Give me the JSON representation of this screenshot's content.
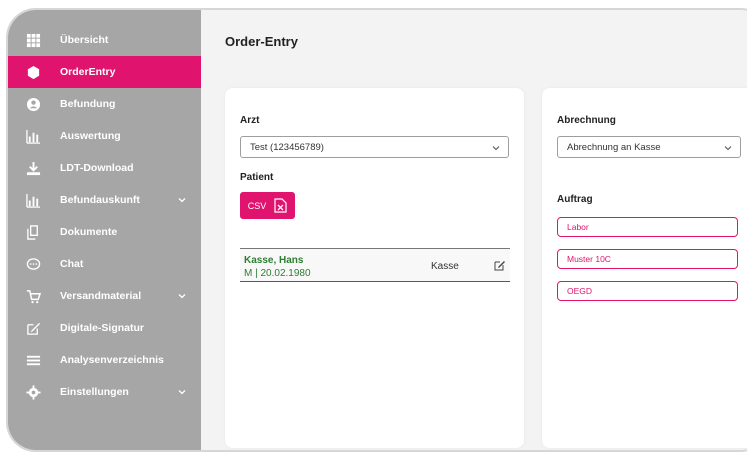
{
  "colors": {
    "accent": "#e0146f",
    "sidebar": "#a6a6a6",
    "patient_green": "#2e7d32"
  },
  "sidebar": {
    "items": [
      {
        "label": "Übersicht",
        "icon": "grid-icon",
        "active": false,
        "has_caret": false
      },
      {
        "label": "OrderEntry",
        "icon": "cube-icon",
        "active": true,
        "has_caret": false
      },
      {
        "label": "Befundung",
        "icon": "user-circle-icon",
        "active": false,
        "has_caret": false
      },
      {
        "label": "Auswertung",
        "icon": "bar-chart-icon",
        "active": false,
        "has_caret": false
      },
      {
        "label": "LDT-Download",
        "icon": "download-icon",
        "active": false,
        "has_caret": false
      },
      {
        "label": "Befundauskunft",
        "icon": "bar-chart-icon",
        "active": false,
        "has_caret": true
      },
      {
        "label": "Dokumente",
        "icon": "documents-icon",
        "active": false,
        "has_caret": false
      },
      {
        "label": "Chat",
        "icon": "chat-icon",
        "active": false,
        "has_caret": false
      },
      {
        "label": "Versandmaterial",
        "icon": "cart-icon",
        "active": false,
        "has_caret": true
      },
      {
        "label": "Digitale-Signatur",
        "icon": "edit-icon",
        "active": false,
        "has_caret": false
      },
      {
        "label": "Analysenverzeichnis",
        "icon": "list-icon",
        "active": false,
        "has_caret": false
      },
      {
        "label": "Einstellungen",
        "icon": "gear-icon",
        "active": false,
        "has_caret": true
      }
    ]
  },
  "main": {
    "title": "Order-Entry",
    "left_card": {
      "arzt_label": "Arzt",
      "arzt_value": "Test (123456789)",
      "patient_label": "Patient",
      "csv_label": "CSV",
      "patient": {
        "name": "Kasse, Hans",
        "info": "M | 20.02.1980",
        "type": "Kasse"
      }
    },
    "right_card": {
      "abrechnung_label": "Abrechnung",
      "abrechnung_value": "Abrechnung an Kasse",
      "auftrag_label": "Auftrag",
      "orders": [
        "Labor",
        "Muster 10C",
        "OEGD"
      ]
    }
  }
}
